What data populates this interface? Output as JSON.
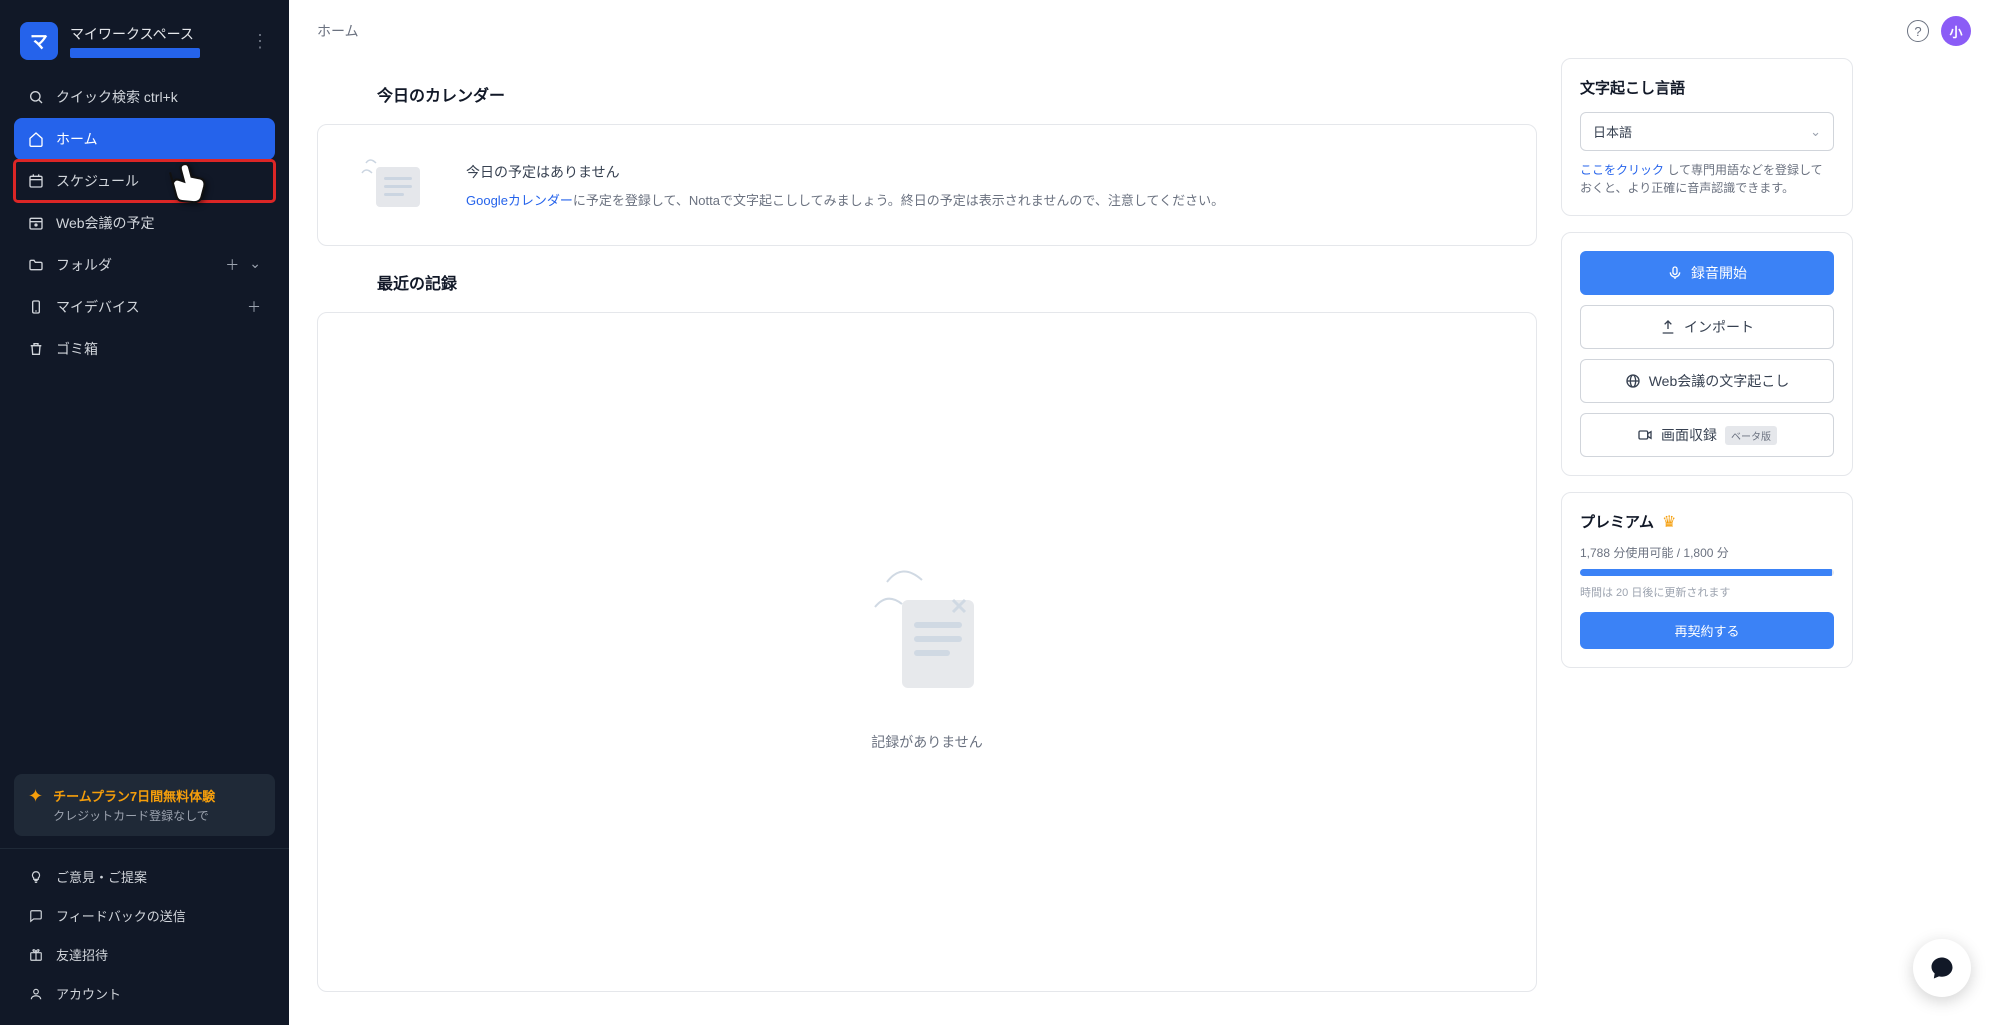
{
  "workspace": {
    "badge_letter": "マ",
    "name": "マイワークスペース"
  },
  "sidebar": {
    "quick_search": "クイック検索 ctrl+k",
    "items": {
      "home": "ホーム",
      "schedule": "スケジュール",
      "web_meeting": "Web会議の予定",
      "folder": "フォルダ",
      "my_device": "マイデバイス",
      "trash": "ゴミ箱"
    },
    "promo": {
      "title": "チームプラン7日間無料体験",
      "sub": "クレジットカード登録なしで"
    },
    "footer": {
      "feedback_idea": "ご意見・ご提案",
      "send_feedback": "フィードバックの送信",
      "invite": "友達招待",
      "account": "アカウント"
    }
  },
  "topbar": {
    "title": "ホーム",
    "avatar_letter": "小"
  },
  "calendar": {
    "section_title": "今日のカレンダー",
    "empty_title": "今日の予定はありません",
    "link_text": "Googleカレンダー",
    "empty_desc_rest": "に予定を登録して、Nottaで文字起こししてみましょう。終日の予定は表示されませんので、注意してください。"
  },
  "records": {
    "section_title": "最近の記録",
    "empty": "記録がありません"
  },
  "right": {
    "lang_title": "文字起こし言語",
    "lang_value": "日本語",
    "lang_hint_link": "ここをクリック",
    "lang_hint_rest": " して専門用語などを登録しておくと、より正確に音声認識できます。",
    "btn_record": "録音開始",
    "btn_import": "インポート",
    "btn_web": "Web会議の文字起こし",
    "btn_screen": "画面収録",
    "btn_screen_badge": "ベータ版",
    "premium": {
      "title": "プレミアム",
      "usage_used": "1,788",
      "usage_total": "1,800",
      "usage_unit": "分",
      "usage_label_used": "分使用可能",
      "percent": 99.3,
      "renew_note": "時間は 20 日後に更新されます",
      "renew_btn": "再契約する"
    }
  }
}
